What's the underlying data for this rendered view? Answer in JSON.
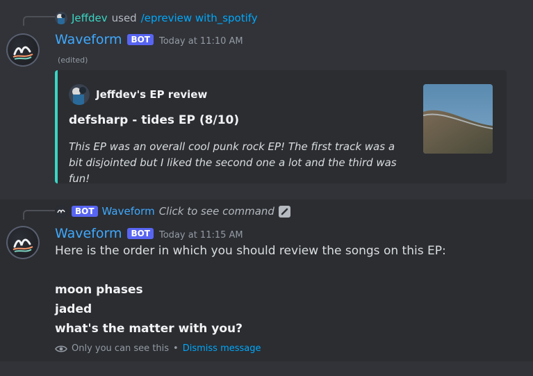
{
  "messages": [
    {
      "reply": {
        "user": "Jeffdev",
        "verb": "used",
        "command": "/epreview with_spotify"
      },
      "author": "Waveform",
      "badge": "BOT",
      "timestamp": "Today at 11:10 AM",
      "edited": "(edited)",
      "embed": {
        "author": "Jeffdev's EP review",
        "title": "defsharp - tides EP (8/10)",
        "description": "This EP was an overall cool punk rock EP! The first track was a bit disjointed but I liked the second one a lot and the third was fun!",
        "accent_color": "#3ad6c3"
      }
    },
    {
      "reply": {
        "badge": "BOT",
        "user": "Waveform",
        "text": "Click to see command"
      },
      "author": "Waveform",
      "badge": "BOT",
      "timestamp": "Today at 11:15 AM",
      "content": "Here is the order in which you should review the songs on this EP:",
      "tracks": [
        "moon phases",
        "jaded",
        "what's the matter with you?"
      ],
      "ephemeral_notice": "Only you can see this",
      "separator": "•",
      "dismiss_label": "Dismiss message"
    }
  ],
  "colors": {
    "username": "#3fa9ff",
    "bot_badge": "#5865f2",
    "link": "#00a8fc"
  }
}
